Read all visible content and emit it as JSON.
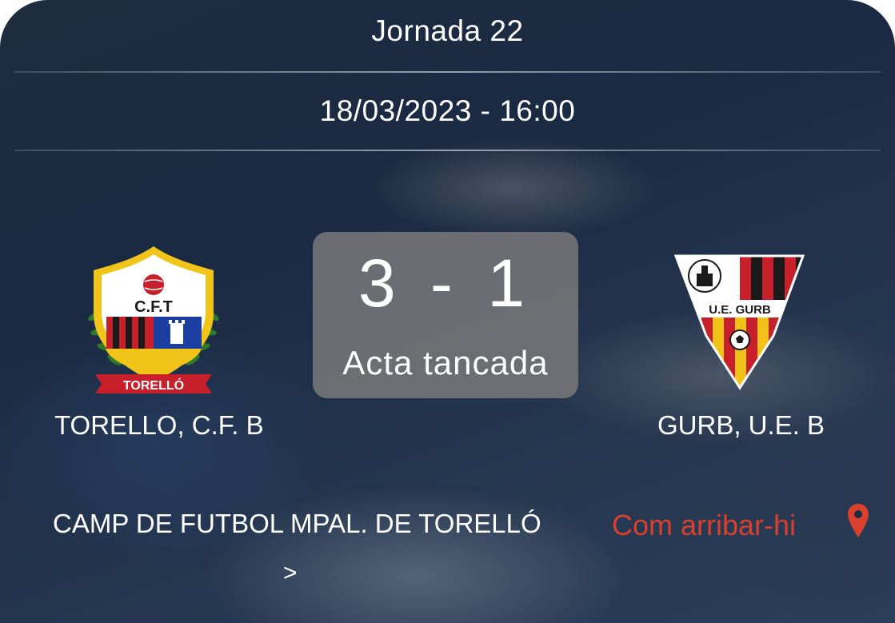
{
  "match": {
    "round": "Jornada 22",
    "datetime": "18/03/2023 - 16:00",
    "score": "3 - 1",
    "status": "Acta tancada"
  },
  "home_team": {
    "name": "TORELLO, C.F. B",
    "crest_icon": "torello-cft-crest-icon",
    "crest_text_top": "C.F.T",
    "crest_text_banner": "TORELLÓ"
  },
  "away_team": {
    "name": "GURB, U.E. B",
    "crest_icon": "ue-gurb-crest-icon",
    "crest_text": "U.E. GURB"
  },
  "venue": {
    "name": "CAMP DE FUTBOL MPAL. DE TORELLÓ",
    "arrow": ">"
  },
  "directions": {
    "label": "Com arribar-hi",
    "icon": "map-pin-icon",
    "color": "#d9402e"
  },
  "colors": {
    "accent_red": "#d9402e",
    "score_box": "#737376"
  }
}
